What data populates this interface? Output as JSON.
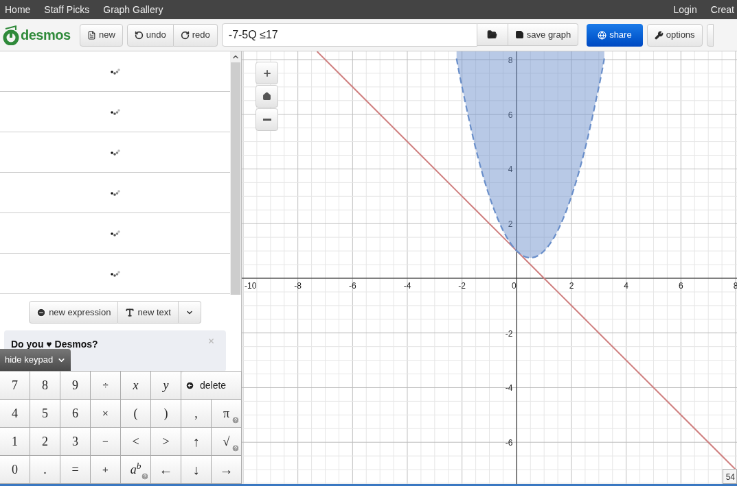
{
  "nav": {
    "left": [
      "Home",
      "Staff Picks",
      "Graph Gallery"
    ],
    "right": [
      "Login",
      "Creat"
    ]
  },
  "toolbar": {
    "logo": "desmos",
    "new": "new",
    "undo": "undo",
    "redo": "redo",
    "expression": {
      "value": "-7-5Q ≤17"
    },
    "save": "save graph",
    "share": "share",
    "options": "options"
  },
  "expressions": [
    {
      "kind": "loading"
    },
    {
      "kind": "loading"
    },
    {
      "kind": "loading"
    },
    {
      "kind": "loading"
    },
    {
      "kind": "loading"
    },
    {
      "kind": "loading"
    }
  ],
  "add_buttons": {
    "new_expression": "new expression",
    "new_text": "new text"
  },
  "promo": {
    "title": "Do you ♥ Desmos?"
  },
  "keypad": {
    "toggle": "hide keypad",
    "rows": [
      [
        {
          "label": "7"
        },
        {
          "label": "8"
        },
        {
          "label": "9"
        },
        {
          "label": "÷",
          "kind": "op"
        },
        {
          "label": "x",
          "kind": "var"
        },
        {
          "label": "y",
          "kind": "var"
        },
        {
          "label": "delete",
          "kind": "delete"
        }
      ],
      [
        {
          "label": "4"
        },
        {
          "label": "5"
        },
        {
          "label": "6"
        },
        {
          "label": "×",
          "kind": "op"
        },
        {
          "label": "("
        },
        {
          "label": ")"
        },
        {
          "label": ","
        },
        {
          "label": "π",
          "help": true
        }
      ],
      [
        {
          "label": "1"
        },
        {
          "label": "2"
        },
        {
          "label": "3"
        },
        {
          "label": "−",
          "kind": "op"
        },
        {
          "label": "<"
        },
        {
          "label": ">"
        },
        {
          "label": "↑",
          "kind": "arrow"
        },
        {
          "label": "√",
          "help": true
        }
      ],
      [
        {
          "label": "0"
        },
        {
          "label": "."
        },
        {
          "label": "="
        },
        {
          "label": "+",
          "kind": "op"
        },
        {
          "label": "a$^{b}$",
          "kind": "var",
          "help": true
        },
        {
          "label": "←",
          "kind": "arrow"
        },
        {
          "label": "↓",
          "kind": "arrow"
        },
        {
          "label": "→",
          "kind": "arrow"
        }
      ]
    ]
  },
  "graph": {
    "chart_data": {
      "type": "line",
      "grid": true,
      "xlim": [
        -10.05,
        8.05
      ],
      "ylim": [
        -7.6,
        8.3
      ],
      "xticks": [
        -10,
        -8,
        -6,
        -4,
        -2,
        0,
        2,
        4,
        6,
        8
      ],
      "yticks": [
        -6,
        -4,
        -2,
        2,
        4,
        6,
        8
      ],
      "x": [
        -7.3,
        -2.2,
        -2,
        -1.5,
        -1,
        -0.5,
        0,
        0.5,
        1,
        1.5,
        2,
        2.5,
        3,
        3.2,
        8
      ],
      "series": [
        {
          "color": "#cf7f7f",
          "line_style": "solid",
          "values": [
            8.3,
            3.2,
            3,
            2.5,
            2,
            1.5,
            1,
            0.5,
            0,
            -0.5,
            -1,
            -1.5,
            -2,
            -2.2,
            -7
          ]
        },
        {
          "color": "#6a8fca",
          "line_style": "dashed",
          "values": [
            null,
            8.04,
            7,
            4.75,
            3,
            1.75,
            1,
            0.75,
            1,
            1.75,
            3,
            4.75,
            7,
            8.04,
            null
          ]
        }
      ]
    },
    "corner_badge": "54"
  }
}
